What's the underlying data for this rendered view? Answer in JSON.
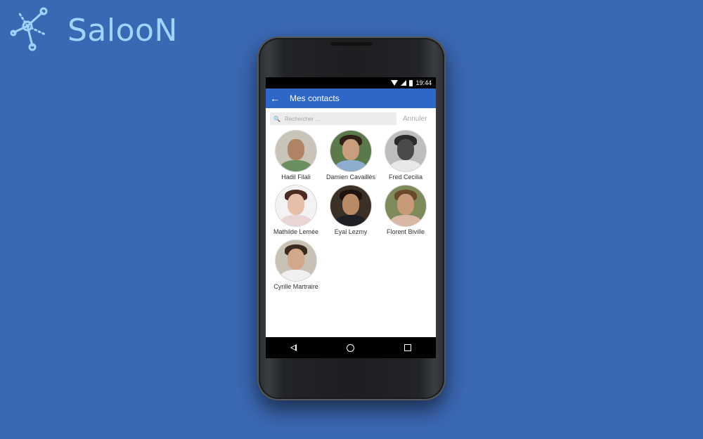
{
  "brand": {
    "name": "SalooN",
    "logo_icon": "network-nodes-icon",
    "color": "#9fd4ff"
  },
  "colors": {
    "background": "#3b68b3",
    "appbar": "#2f67c9"
  },
  "status_bar": {
    "time": "19:44",
    "icons": [
      "wifi-icon",
      "signal-icon",
      "battery-icon"
    ]
  },
  "app_bar": {
    "back_icon": "arrow-left-icon",
    "title": "Mes contacts"
  },
  "search": {
    "placeholder": "Rechercher ...",
    "value": "",
    "cancel_label": "Annuler"
  },
  "contacts": [
    {
      "name": "Hadil Filali"
    },
    {
      "name": "Damien Cavaillès"
    },
    {
      "name": "Fred Cecilia"
    },
    {
      "name": "Mathilde Lemée"
    },
    {
      "name": "Eyal Lezmy"
    },
    {
      "name": "Florent Biville"
    },
    {
      "name": "Cyrille Martraire"
    }
  ],
  "nav_bar": {
    "icons": [
      "nav-back-icon",
      "nav-home-icon",
      "nav-recents-icon"
    ]
  }
}
